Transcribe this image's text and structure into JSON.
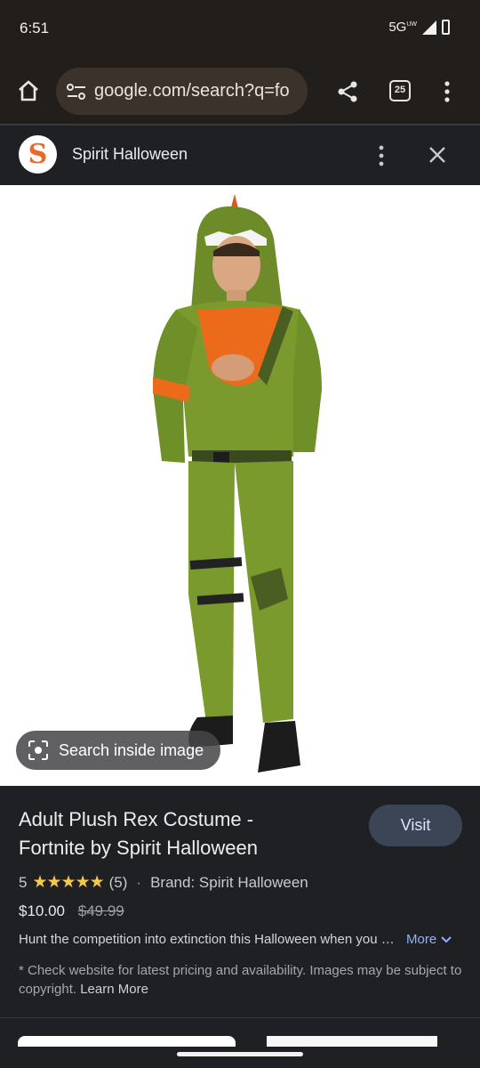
{
  "status_bar": {
    "time": "6:51",
    "network": "5G",
    "network_suffix": "UW"
  },
  "browser": {
    "url": "google.com/search?q=fo",
    "tab_count": "25"
  },
  "source": {
    "logo_letter": "S",
    "name": "Spirit Halloween"
  },
  "image": {
    "lens_label": "Search inside image"
  },
  "product": {
    "title": "Adult Plush Rex Costume - Fortnite by Spirit Halloween",
    "visit_label": "Visit",
    "rating_value": "5",
    "stars": "★★★★★",
    "rating_count": "(5)",
    "brand": "Brand: Spirit Halloween",
    "price": "$10.00",
    "original_price": "$49.99",
    "description": "Hunt the competition into extinction this Halloween when you step out in this officially licensed Fortnite costume",
    "more_label": "More",
    "disclaimer": "* Check website for latest pricing and availability. Images may be subject to copyright.",
    "learn_more_label": "Learn More"
  },
  "colors": {
    "accent_link": "#8ab4f8",
    "star": "#f7c948",
    "brand_orange": "#e86a2b",
    "visit_button_bg": "#3c4556"
  }
}
